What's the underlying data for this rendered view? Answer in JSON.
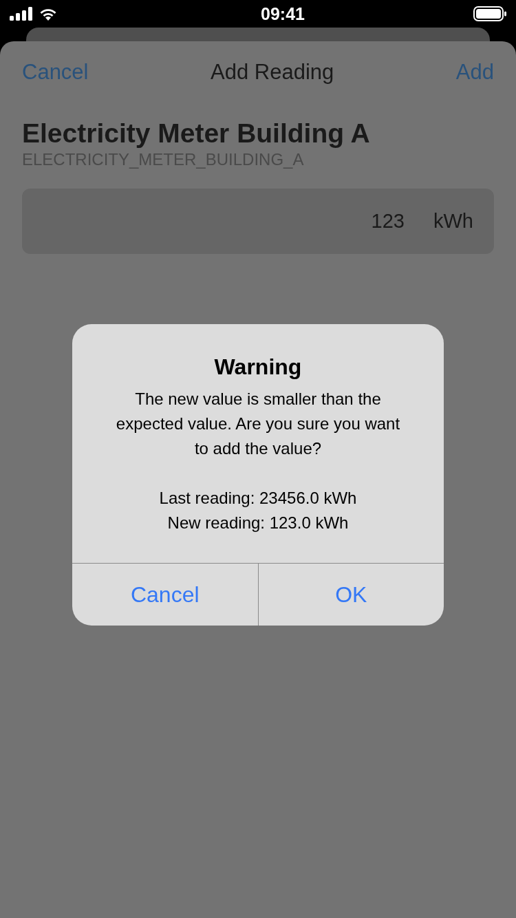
{
  "status_bar": {
    "time": "09:41"
  },
  "nav": {
    "cancel": "Cancel",
    "title": "Add Reading",
    "add": "Add"
  },
  "meter": {
    "name": "Electricity Meter Building A",
    "code": "ELECTRICITY_METER_BUILDING_A"
  },
  "reading_field": {
    "value": "123",
    "unit": "kWh"
  },
  "alert": {
    "title": "Warning",
    "message": "The new value is smaller than the expected value. Are you sure you want to add the value?",
    "details": [
      "Last reading: 23456.0 kWh",
      "New reading: 123.0 kWh"
    ],
    "buttons": [
      "Cancel",
      "OK"
    ]
  }
}
